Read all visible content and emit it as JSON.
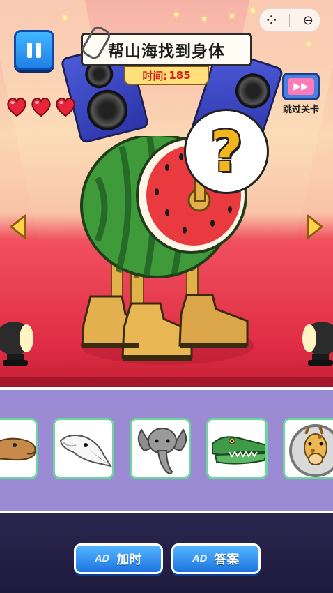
{
  "game": {
    "title": "帮山海找到身体",
    "timer_label": "时间:",
    "timer_value": "185",
    "lives": 3,
    "skip_label": "跳过关卡",
    "question_mark": "?"
  },
  "choices": [
    {
      "animal": "camel"
    },
    {
      "animal": "swan"
    },
    {
      "animal": "elephant"
    },
    {
      "animal": "crocodile"
    },
    {
      "animal": "giraffe"
    }
  ],
  "buttons": {
    "ad_tag": "AD",
    "add_time_label": "加时",
    "answer_label": "答案"
  },
  "colors": {
    "panel": "#9a8bd4",
    "card_border": "#6bd89a",
    "button_blue": "#1e74df",
    "timer_text": "#d6271d"
  }
}
